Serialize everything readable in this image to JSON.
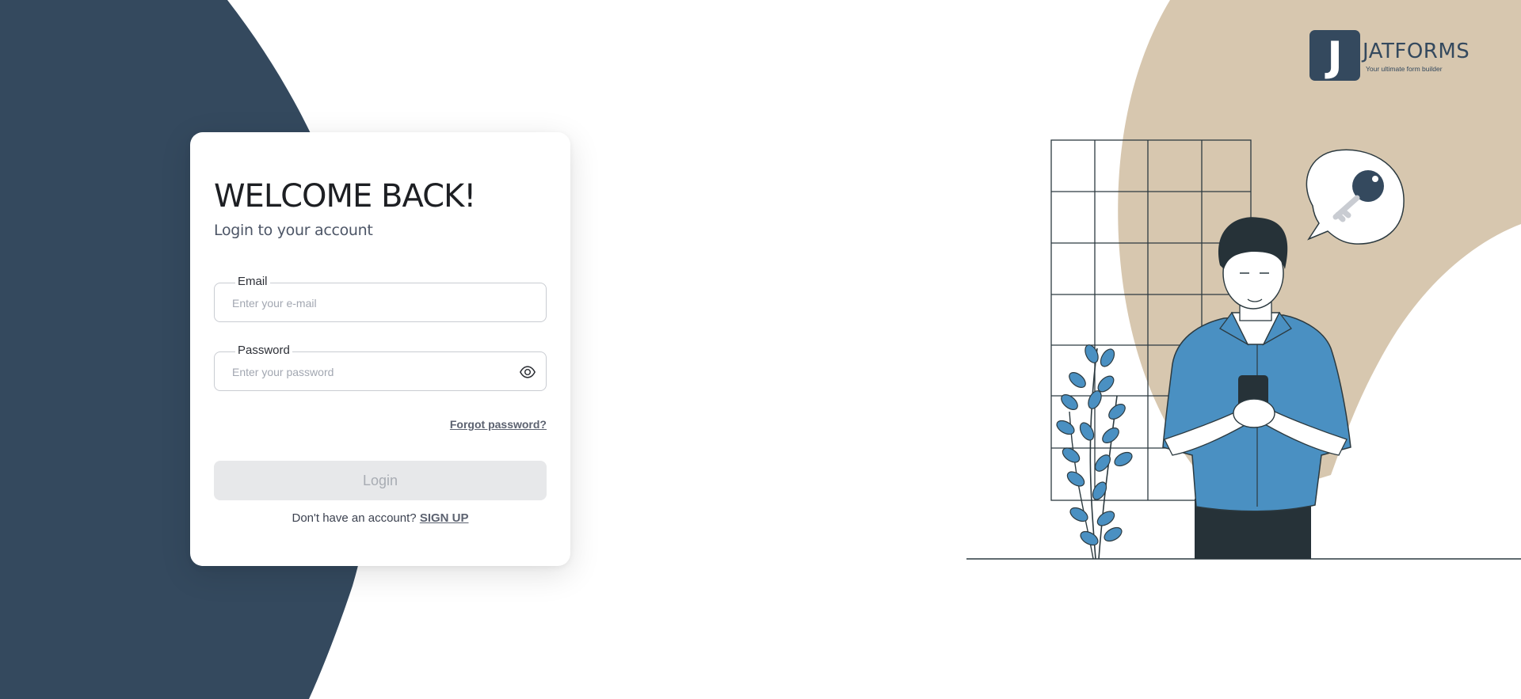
{
  "card": {
    "title": "WELCOME BACK!",
    "subtitle": "Login to your account",
    "email": {
      "label": "Email",
      "placeholder": "Enter your e-mail",
      "value": ""
    },
    "password": {
      "label": "Password",
      "placeholder": "Enter your password",
      "value": ""
    },
    "show_password_icon": "eye-icon",
    "forgot_password": "Forgot password?",
    "login_button": "Login",
    "signup_prompt": "Don't have an account?",
    "signup_link": "SIGN UP"
  },
  "brand": {
    "logo_letter": "J",
    "name": "JATFORMS",
    "tagline": "Your ultimate form builder"
  },
  "colors": {
    "navy": "#34495e",
    "beige": "#d7c7af",
    "shirt_blue": "#4a90c2",
    "button_disabled": "#e7e8ea"
  }
}
